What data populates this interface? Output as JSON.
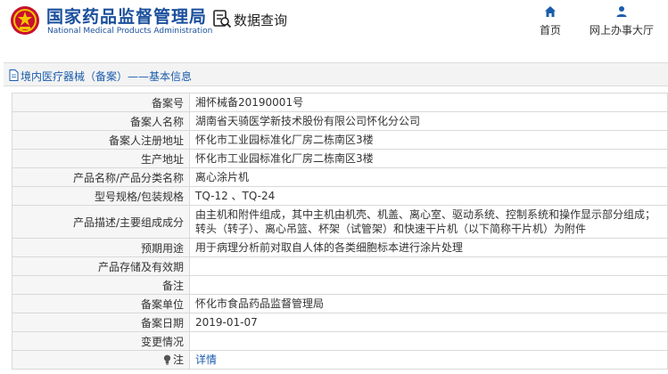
{
  "header": {
    "org_name_cn": "国家药品监督管理局",
    "org_name_en": "National Medical Products Administration",
    "query_label": "数据查询",
    "nav": [
      {
        "label": "首页",
        "icon": "home-icon"
      },
      {
        "label": "网上办事大厅",
        "icon": "user-icon"
      }
    ]
  },
  "breadcrumb": {
    "text": "境内医疗器械（备案）——基本信息",
    "icon": "document-icon"
  },
  "colors": {
    "brand_blue": "#1a4f9c",
    "link_blue": "#1a5cab",
    "label_bg": "#f6f6f6",
    "border": "#d9d9d9"
  },
  "record": {
    "rows": [
      {
        "label": "备案号",
        "value": "湘怀械备20190001号"
      },
      {
        "label": "备案人名称",
        "value": "湖南省天骑医学新技术股份有限公司怀化分公司"
      },
      {
        "label": "备案人注册地址",
        "value": "怀化市工业园标准化厂房二栋南区3楼"
      },
      {
        "label": "生产地址",
        "value": "怀化市工业园标准化厂房二栋南区3楼"
      },
      {
        "label": "产品名称/产品分类名称",
        "value": "离心涂片机"
      },
      {
        "label": "型号规格/包装规格",
        "value": "TQ-12 、TQ-24"
      },
      {
        "label": "产品描述/主要组成成分",
        "value": "由主机和附件组成，其中主机由机壳、机盖、离心室、驱动系统、控制系统和操作显示部分组成；转头（转子）、离心吊篮、杯架（试管架）和快速干片机（以下简称干片机）为附件"
      },
      {
        "label": "预期用途",
        "value": "用于病理分析前对取自人体的各类细胞标本进行涂片处理"
      },
      {
        "label": "产品存储及有效期",
        "value": ""
      },
      {
        "label": "备注",
        "value": ""
      },
      {
        "label": "备案单位",
        "value": "怀化市食品药品监督管理局"
      },
      {
        "label": "备案日期",
        "value": "2019-01-07"
      },
      {
        "label": "变更情况",
        "value": ""
      }
    ],
    "note_row": {
      "label": "注",
      "icon": "lightbulb-icon",
      "link_text": "详情"
    }
  }
}
